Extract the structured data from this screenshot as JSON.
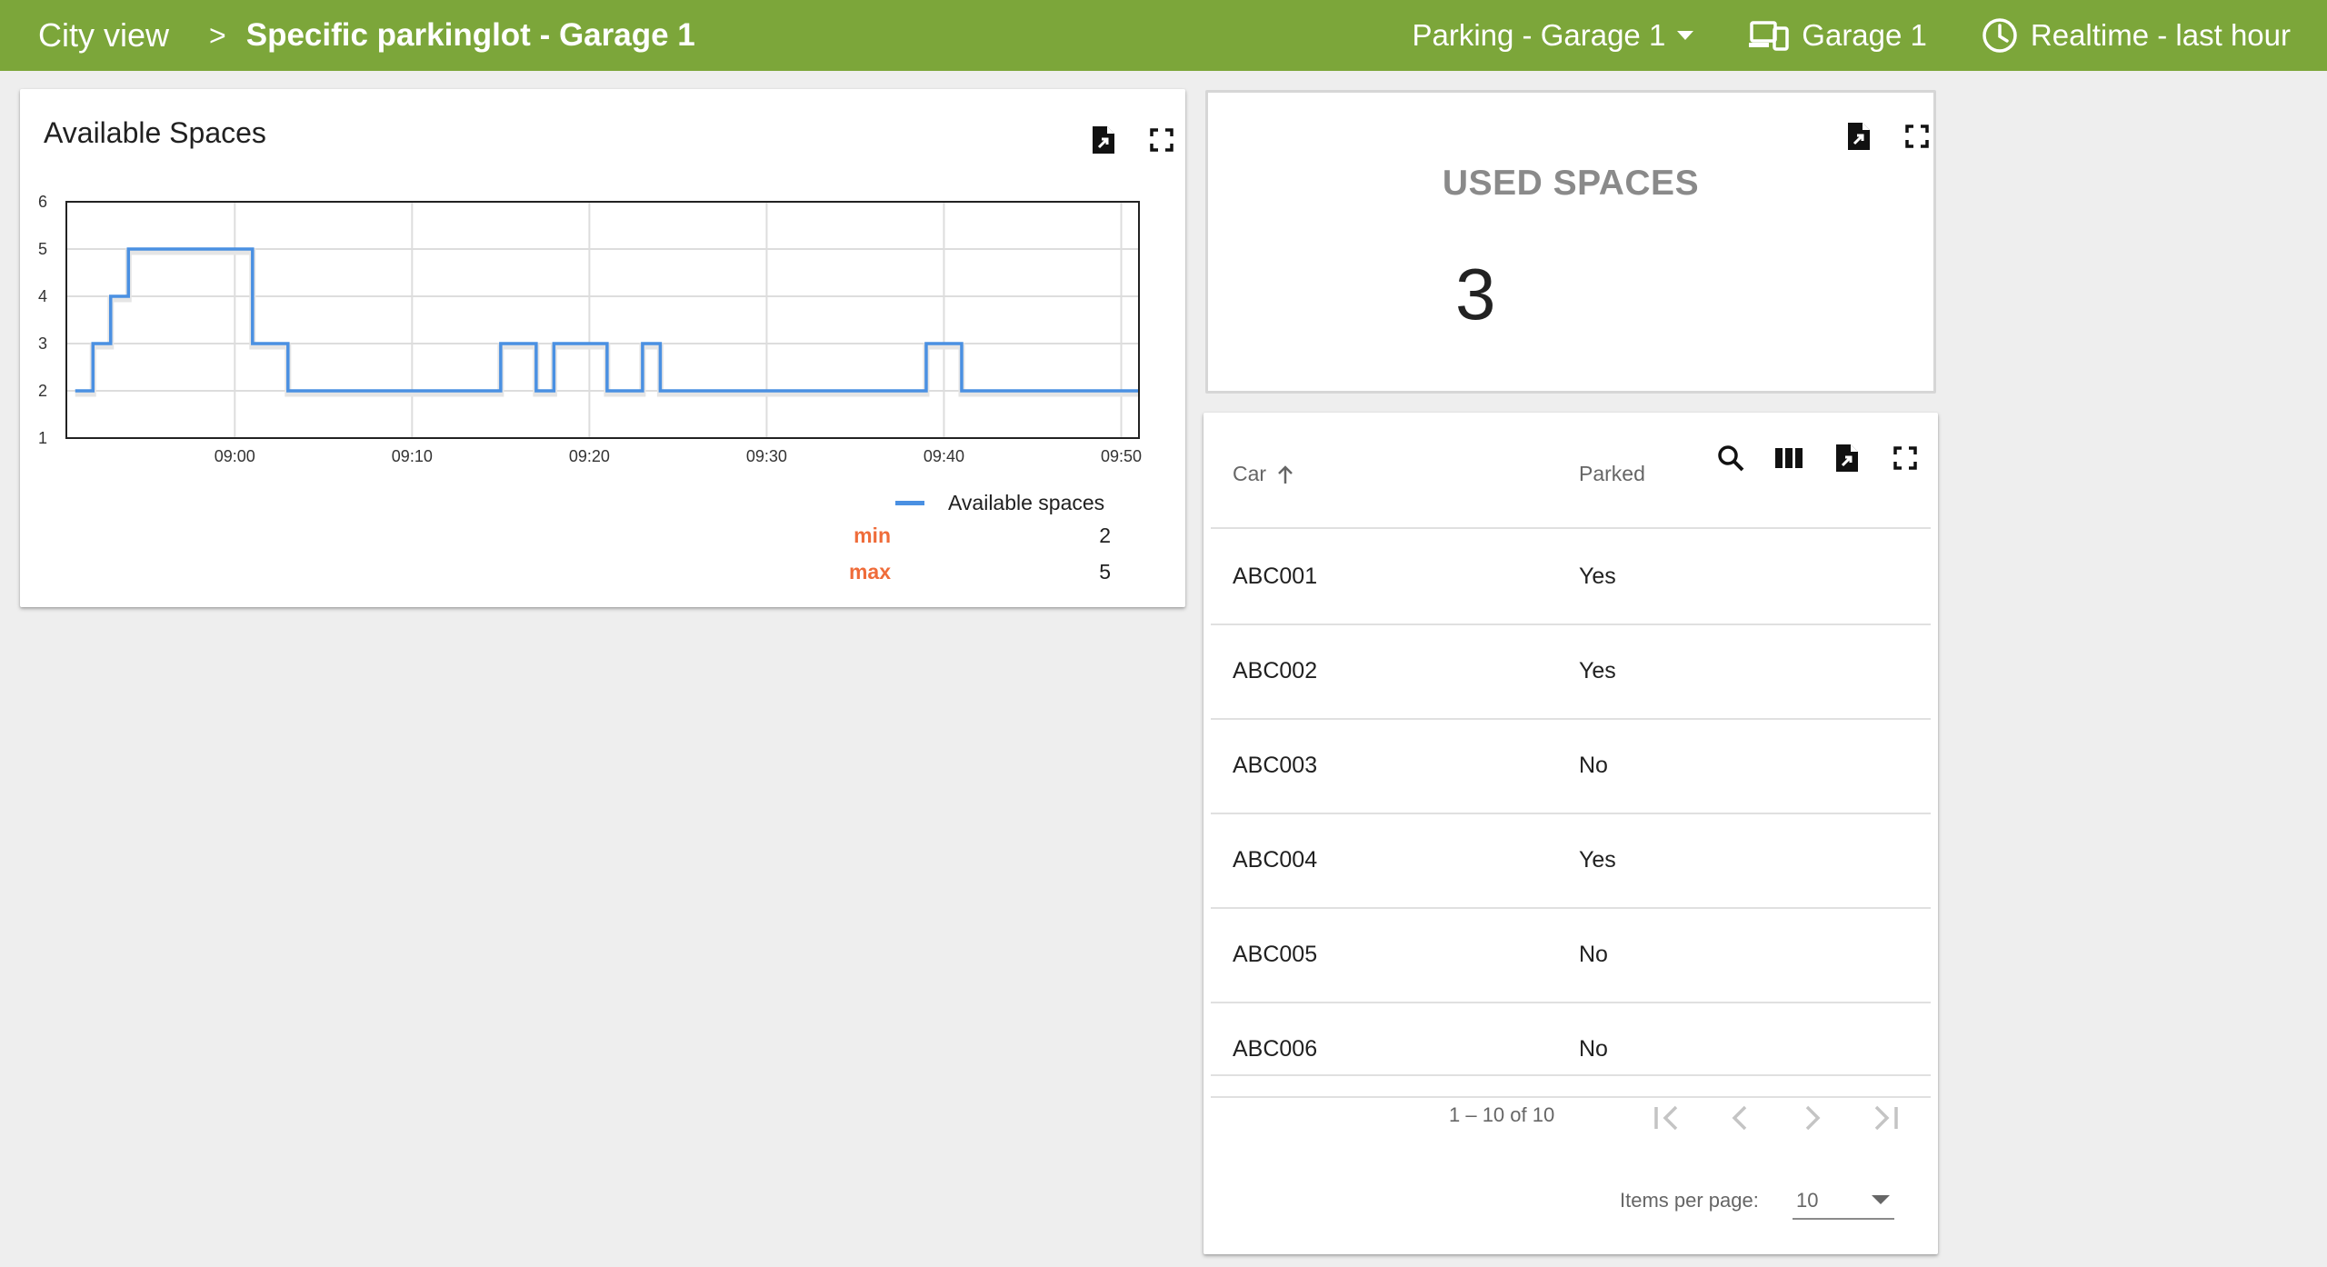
{
  "header": {
    "breadcrumb_root": "City view",
    "breadcrumb_separator": ">",
    "breadcrumb_current": "Specific parkinglot - Garage 1",
    "state_selector": "Parking - Garage 1",
    "entity": "Garage 1",
    "timewindow": "Realtime - last hour"
  },
  "colors": {
    "header_bg": "#7ca63a",
    "series": "#4a90e2",
    "stat_label": "#ef6c3a"
  },
  "chart_card": {
    "title": "Available Spaces",
    "icons": [
      "export-icon",
      "fullscreen-icon"
    ]
  },
  "chart_data": {
    "type": "line",
    "step": true,
    "title": "Available Spaces",
    "xlabel": "",
    "ylabel": "",
    "x_ticks": [
      "09:00",
      "09:10",
      "09:20",
      "09:30",
      "09:40",
      "09:50"
    ],
    "y_ticks": [
      1,
      2,
      3,
      4,
      5,
      6
    ],
    "ylim": [
      1,
      6
    ],
    "grid": true,
    "legend": "bottom-right",
    "series": [
      {
        "name": "Available spaces",
        "points": [
          [
            "08:51",
            2
          ],
          [
            "08:52",
            3
          ],
          [
            "08:53",
            4
          ],
          [
            "08:54",
            5
          ],
          [
            "09:00",
            5
          ],
          [
            "09:01",
            3
          ],
          [
            "09:03",
            2
          ],
          [
            "09:15",
            2
          ],
          [
            "09:15",
            3
          ],
          [
            "09:17",
            2
          ],
          [
            "09:18",
            3
          ],
          [
            "09:21",
            2
          ],
          [
            "09:23",
            3
          ],
          [
            "09:24",
            2
          ],
          [
            "09:39",
            2
          ],
          [
            "09:39",
            3
          ],
          [
            "09:41",
            2
          ],
          [
            "09:51",
            2
          ]
        ]
      }
    ],
    "stats": {
      "min_label": "min",
      "min_value": "2",
      "max_label": "max",
      "max_value": "5"
    }
  },
  "used_card": {
    "title": "USED SPACES",
    "value": "3"
  },
  "table_card": {
    "columns": [
      {
        "label": "Car",
        "sort": "ascending"
      },
      {
        "label": "Parked"
      }
    ],
    "rows": [
      {
        "car": "ABC001",
        "parked": "Yes"
      },
      {
        "car": "ABC002",
        "parked": "Yes"
      },
      {
        "car": "ABC003",
        "parked": "No"
      },
      {
        "car": "ABC004",
        "parked": "Yes"
      },
      {
        "car": "ABC005",
        "parked": "No"
      },
      {
        "car": "ABC006",
        "parked": "No"
      }
    ],
    "paginator": {
      "range": "1 – 10 of 10",
      "items_per_page_label": "Items per page:",
      "items_per_page_value": "10"
    }
  }
}
